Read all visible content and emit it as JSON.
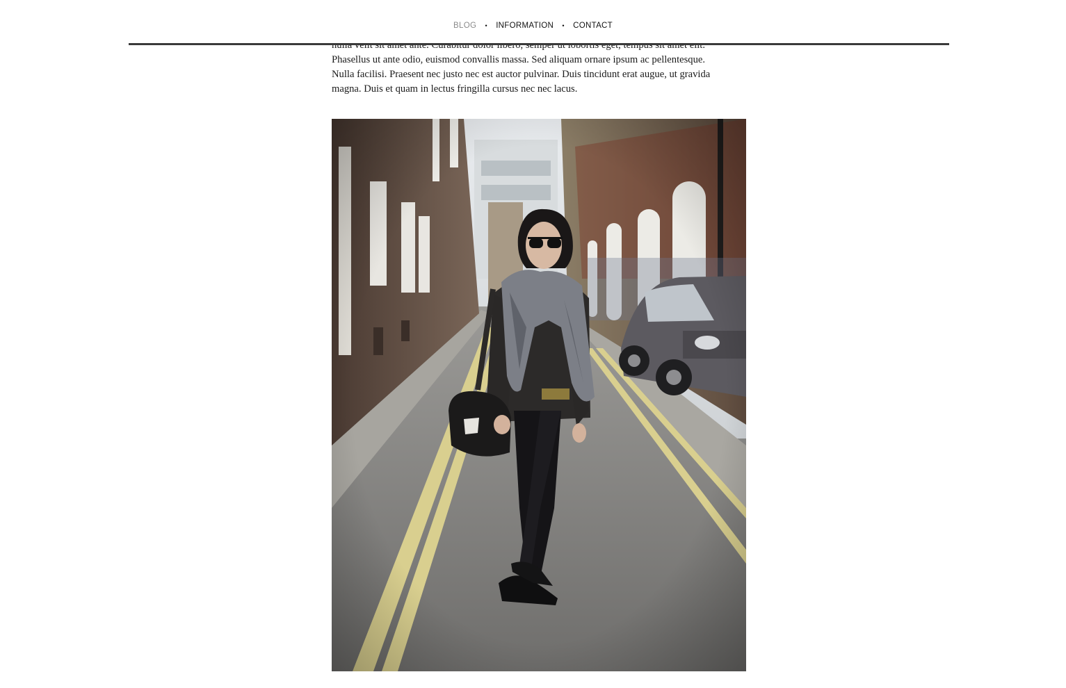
{
  "nav": {
    "items": [
      {
        "label": "BLOG",
        "active": true
      },
      {
        "label": "INFORMATION",
        "active": false
      },
      {
        "label": "CONTACT",
        "active": false
      }
    ],
    "separator": "•"
  },
  "post": {
    "paragraph_lines": [
      "nulla velit sit amet ante. Curabitur dolor libero, semper ut lobortis eget, tempus sit amet elit.",
      "Phasellus ut ante odio, euismod convallis massa. Sed aliquam ornare ipsum ac pellentesque.",
      "Nulla facilisi. Praesent nec justo nec est auctor pulvinar. Duis tincidunt erat augue, ut gravida",
      "magna. Duis et quam in lectus fringilla cursus nec nec lacus."
    ],
    "photo_subject": "street-style-photo"
  },
  "colors": {
    "nav_active": "#8a8a8a",
    "nav_text": "#111111",
    "rule": "#3a3a3a",
    "body_text": "#1a1a1a"
  }
}
